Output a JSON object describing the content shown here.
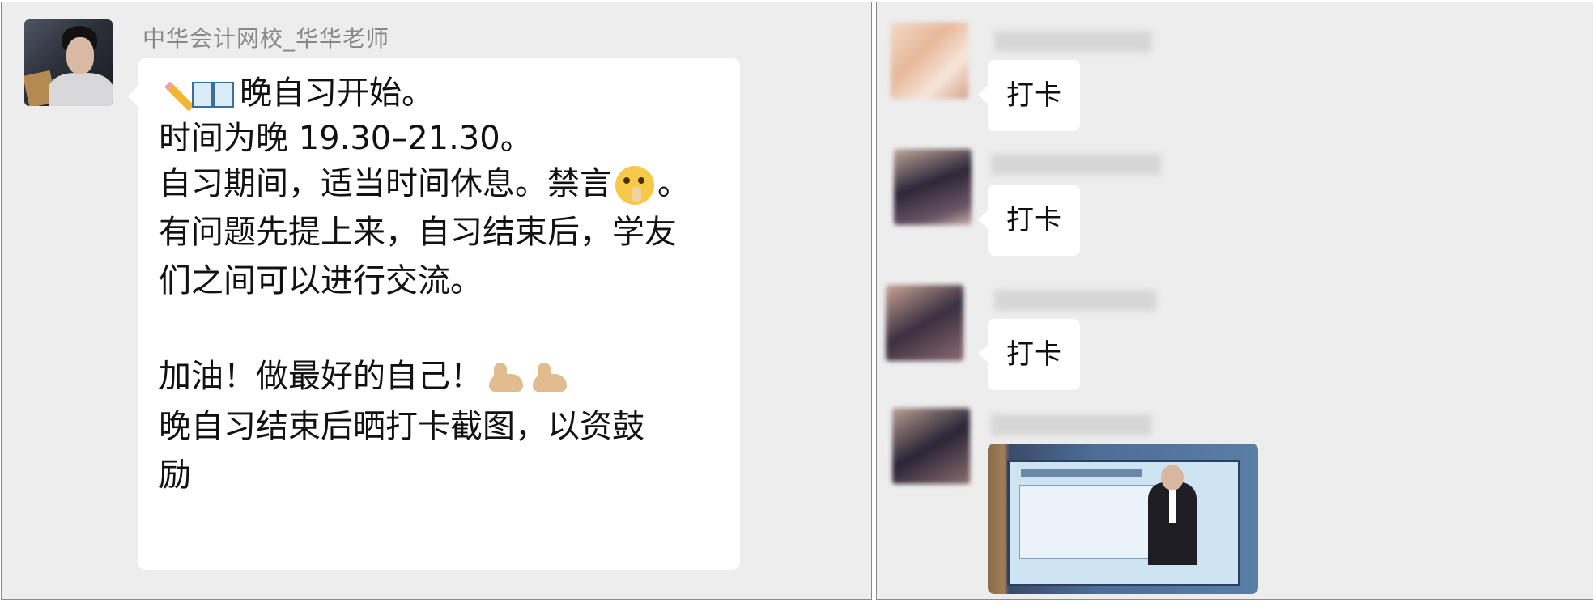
{
  "left_chat": {
    "sender_name": "中华会计网校_华华老师",
    "message_lines": [
      "晚自习开始。",
      "时间为晚 19.30–21.30。",
      "自习期间，适当时间休息。禁言",
      "。",
      "有问题先提上来，自习结束后，学友",
      "们之间可以进行交流。",
      "加油！做最好的自己！",
      "晚自习结束后晒打卡截图，以资鼓",
      "励"
    ],
    "icons": [
      "pencil-icon",
      "open-book-icon",
      "shushing-face-icon",
      "flexed-biceps-icon",
      "flexed-biceps-icon"
    ]
  },
  "right_chat": {
    "messages": [
      {
        "text": "打卡",
        "avatar": "blurred-avatar",
        "name": "blurred"
      },
      {
        "text": "打卡",
        "avatar": "blurred-avatar",
        "name": "blurred"
      },
      {
        "text": "打卡",
        "avatar": "blurred-avatar",
        "name": "blurred"
      }
    ],
    "image_message": {
      "type": "photo",
      "subject": "online lecture screen"
    }
  },
  "colors": {
    "chat_background": "#ededed",
    "bubble": "#ffffff",
    "name_text": "#888888"
  }
}
